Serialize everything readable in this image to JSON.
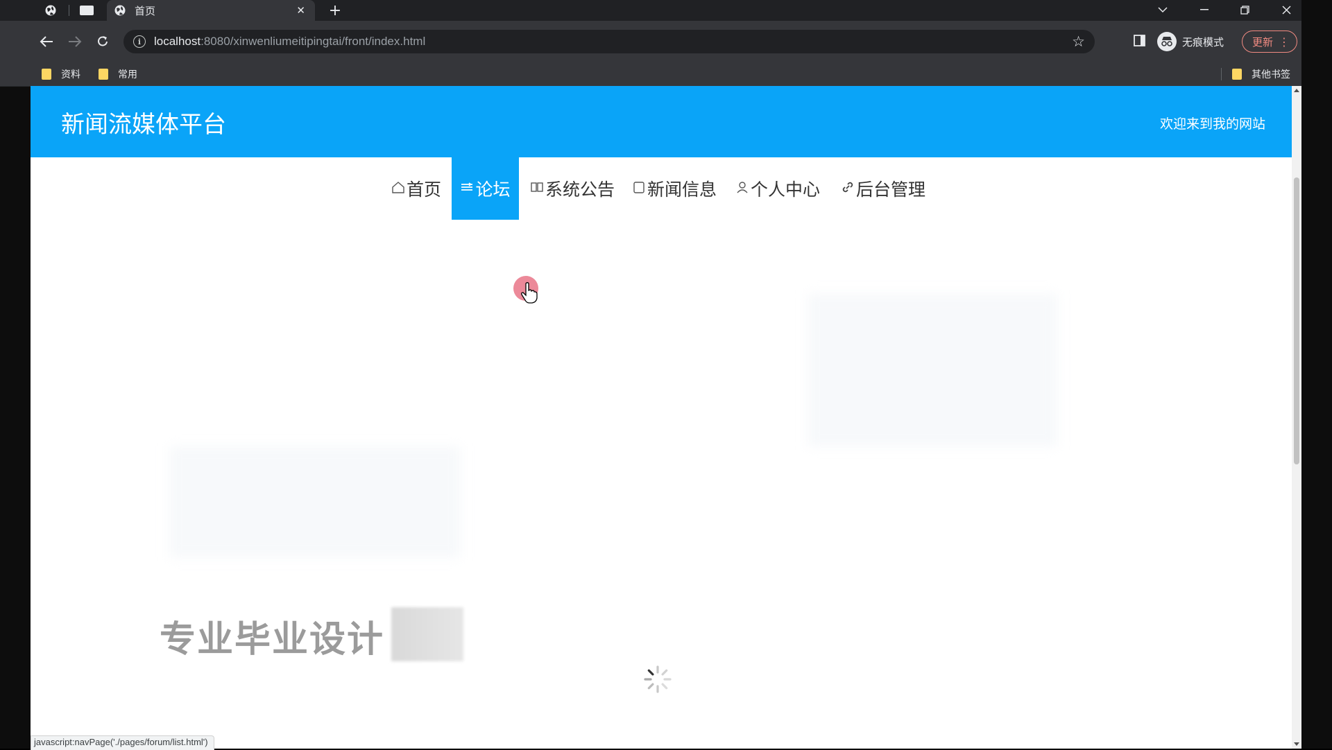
{
  "browser": {
    "tab": {
      "title": "首页"
    },
    "new_tab_icon": "plus-icon",
    "window_controls": [
      "chevron-down-icon",
      "minimize-icon",
      "restore-icon",
      "close-icon"
    ],
    "address": {
      "host": "localhost",
      "path": ":8080/xinwenliumeitipingtai/front/index.html"
    },
    "profile": {
      "label": "无痕模式"
    },
    "update_button": {
      "label": "更新"
    },
    "bookmarks": [
      {
        "label": "资料"
      },
      {
        "label": "常用"
      }
    ],
    "other_bookmarks": "其他书签",
    "status_url": "javascript:navPage('./pages/forum/list.html')"
  },
  "site": {
    "title": "新闻流媒体平台",
    "welcome": "欢迎来到我的网站",
    "accent": "#0aa4f8",
    "nav": [
      {
        "label": "首页",
        "icon": "home-icon"
      },
      {
        "label": "论坛",
        "icon": "forum-icon",
        "active": true
      },
      {
        "label": "系统公告",
        "icon": "book-icon"
      },
      {
        "label": "新闻信息",
        "icon": "news-icon"
      },
      {
        "label": "个人中心",
        "icon": "user-icon"
      },
      {
        "label": "后台管理",
        "icon": "link-icon"
      }
    ]
  },
  "banner": {
    "text": "专业毕业设计"
  }
}
